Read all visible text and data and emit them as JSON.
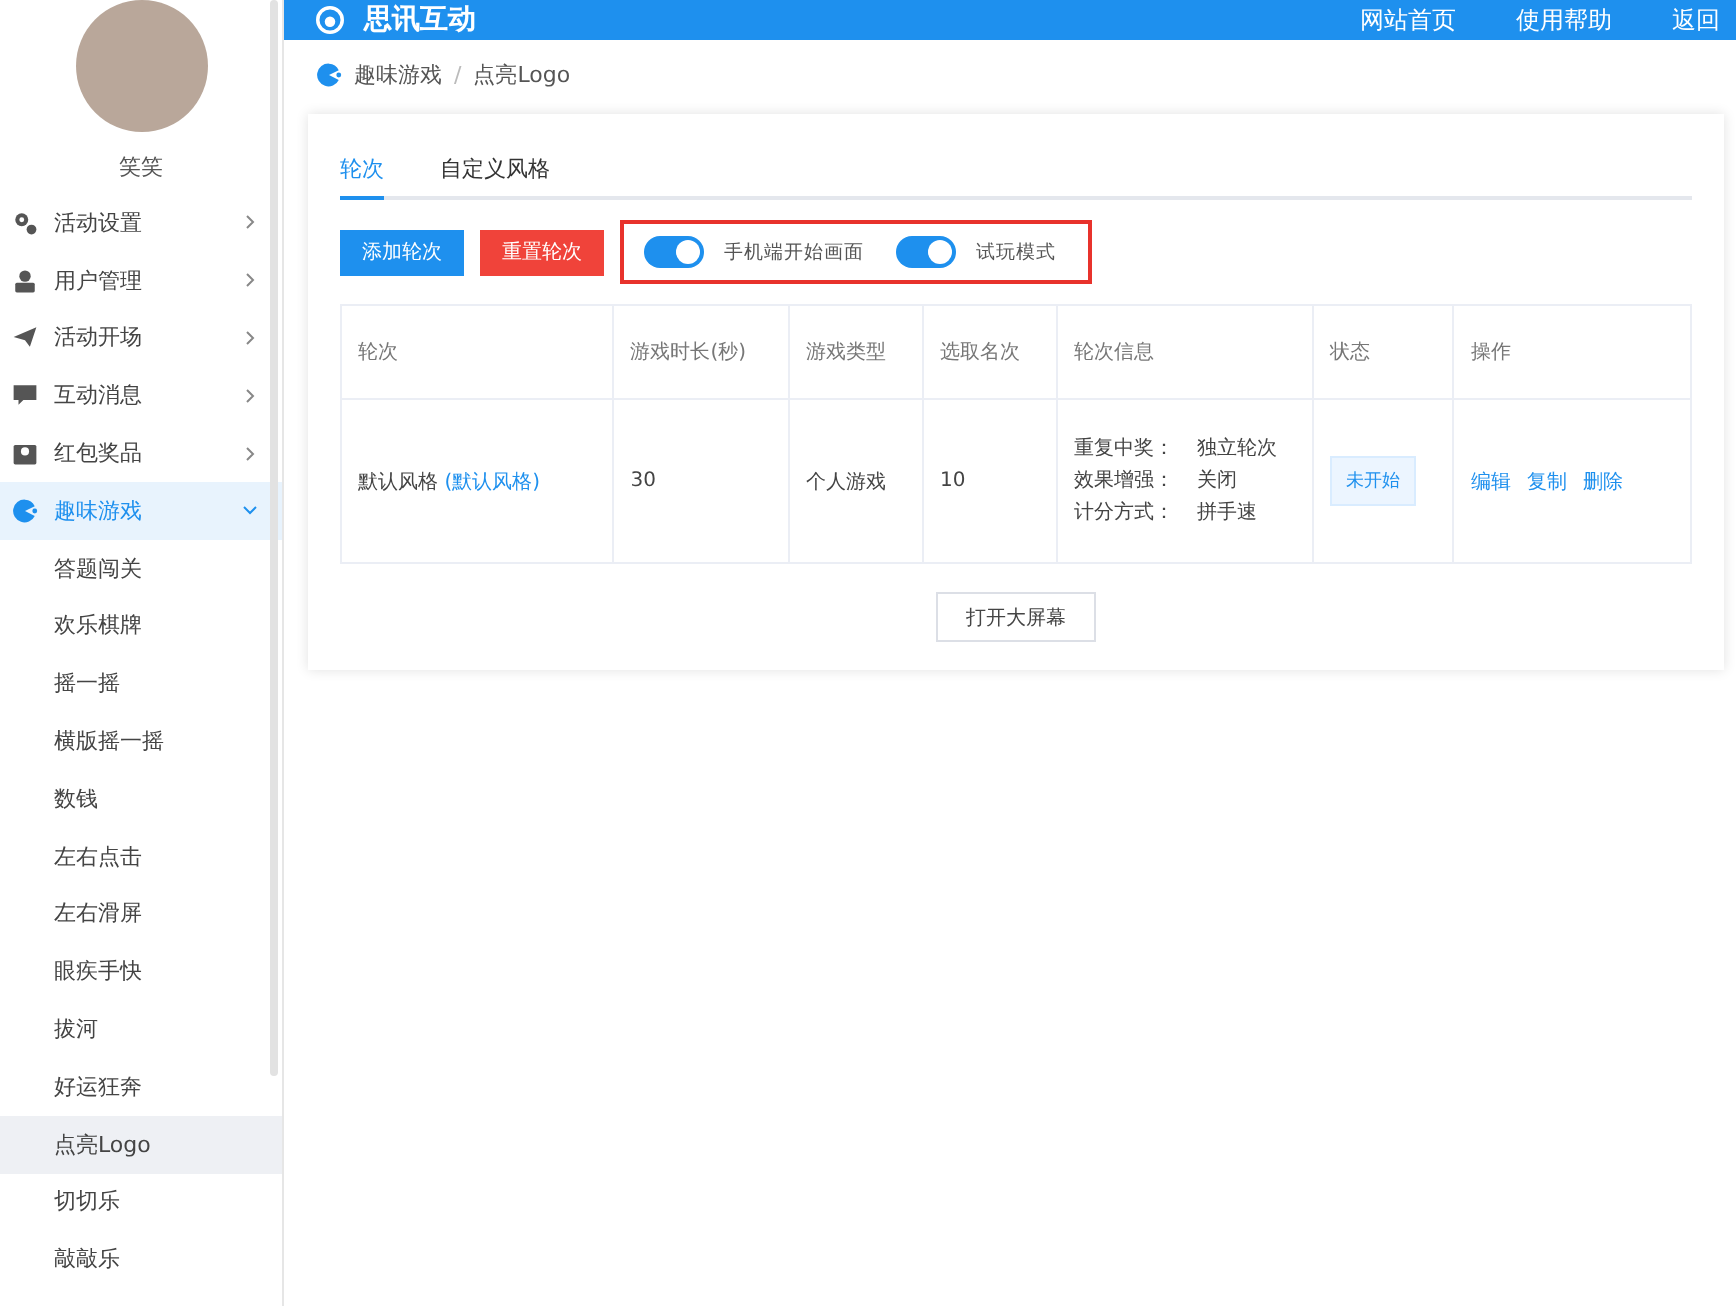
{
  "header": {
    "logo_text": "思讯互动",
    "links": [
      "网站首页",
      "使用帮助",
      "返回"
    ]
  },
  "sidebar": {
    "user_name": "笑笑",
    "items": [
      {
        "label": "活动设置",
        "expanded": false,
        "selected": false
      },
      {
        "label": "用户管理",
        "expanded": false,
        "selected": false
      },
      {
        "label": "活动开场",
        "expanded": false,
        "selected": false
      },
      {
        "label": "互动消息",
        "expanded": false,
        "selected": false
      },
      {
        "label": "红包奖品",
        "expanded": false,
        "selected": false
      },
      {
        "label": "趣味游戏",
        "expanded": true,
        "selected": true,
        "children": [
          {
            "label": "答题闯关",
            "selected": false
          },
          {
            "label": "欢乐棋牌",
            "selected": false
          },
          {
            "label": "摇一摇",
            "selected": false
          },
          {
            "label": "横版摇一摇",
            "selected": false
          },
          {
            "label": "数钱",
            "selected": false
          },
          {
            "label": "左右点击",
            "selected": false
          },
          {
            "label": "左右滑屏",
            "selected": false
          },
          {
            "label": "眼疾手快",
            "selected": false
          },
          {
            "label": "拔河",
            "selected": false
          },
          {
            "label": "好运狂奔",
            "selected": false
          },
          {
            "label": "点亮Logo",
            "selected": true
          },
          {
            "label": "切切乐",
            "selected": false
          },
          {
            "label": "敲敲乐",
            "selected": false
          }
        ]
      }
    ]
  },
  "breadcrumb": {
    "items": [
      "趣味游戏",
      "点亮Logo"
    ],
    "separator": "/"
  },
  "tabs": [
    {
      "label": "轮次",
      "selected": true
    },
    {
      "label": "自定义风格",
      "selected": false
    }
  ],
  "buttons": [
    {
      "label": "添加轮次",
      "kind": "primary"
    },
    {
      "label": "重置轮次",
      "kind": "danger"
    }
  ],
  "toggles": [
    {
      "label": "手机端开始画面",
      "on": true
    },
    {
      "label": "试玩模式",
      "on": true
    }
  ],
  "table": {
    "columns": [
      "轮次",
      "游戏时长(秒)",
      "游戏类型",
      "选取名次",
      "轮次信息",
      "状态",
      "操作"
    ],
    "rows": [
      {
        "round": "默认风格",
        "round_link": "(默认风格)",
        "duration": "30",
        "type": "个人游戏",
        "rank": "10",
        "info": [
          {
            "label": "重复中奖：",
            "value": "独立轮次"
          },
          {
            "label": "效果增强：",
            "value": "关闭"
          },
          {
            "label": "计分方式：",
            "value": "拼手速"
          }
        ],
        "status": "未开始",
        "actions": [
          "编辑",
          "复制",
          "删除"
        ]
      }
    ]
  },
  "footer_button": "打开大屏幕"
}
